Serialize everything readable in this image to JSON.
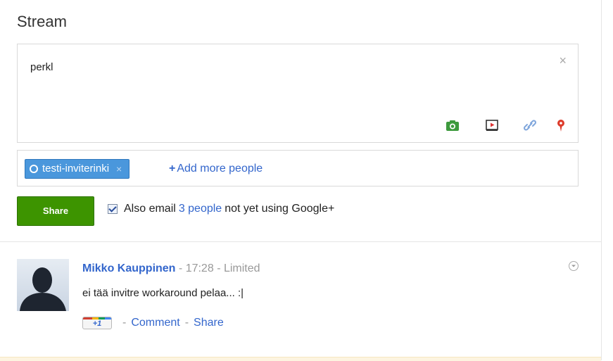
{
  "stream": {
    "title": "Stream"
  },
  "composer": {
    "text": "perkl",
    "close_symbol": "×",
    "tools": [
      "photo-icon",
      "video-icon",
      "link-icon",
      "location-icon"
    ]
  },
  "recipients": {
    "chip_label": "testi-inviterinki",
    "chip_remove": "×",
    "add_more_plus": "+",
    "add_more_label": "Add more people"
  },
  "share_button": {
    "label": "Share"
  },
  "email_option": {
    "checked": true,
    "prefix": "Also email",
    "link": "3 people",
    "suffix": "not yet using Google+"
  },
  "post": {
    "author": "Mikko Kauppinen",
    "separator": "-",
    "time": "17:28",
    "visibility": "Limited",
    "text": "ei tää invitre workaround pelaa... :|",
    "plus_one": "+1",
    "actions": [
      "Comment",
      "Share"
    ]
  },
  "colors": {
    "accent_link": "#3366cc",
    "share_green": "#3d9400",
    "chip_blue": "#4a97dc"
  }
}
